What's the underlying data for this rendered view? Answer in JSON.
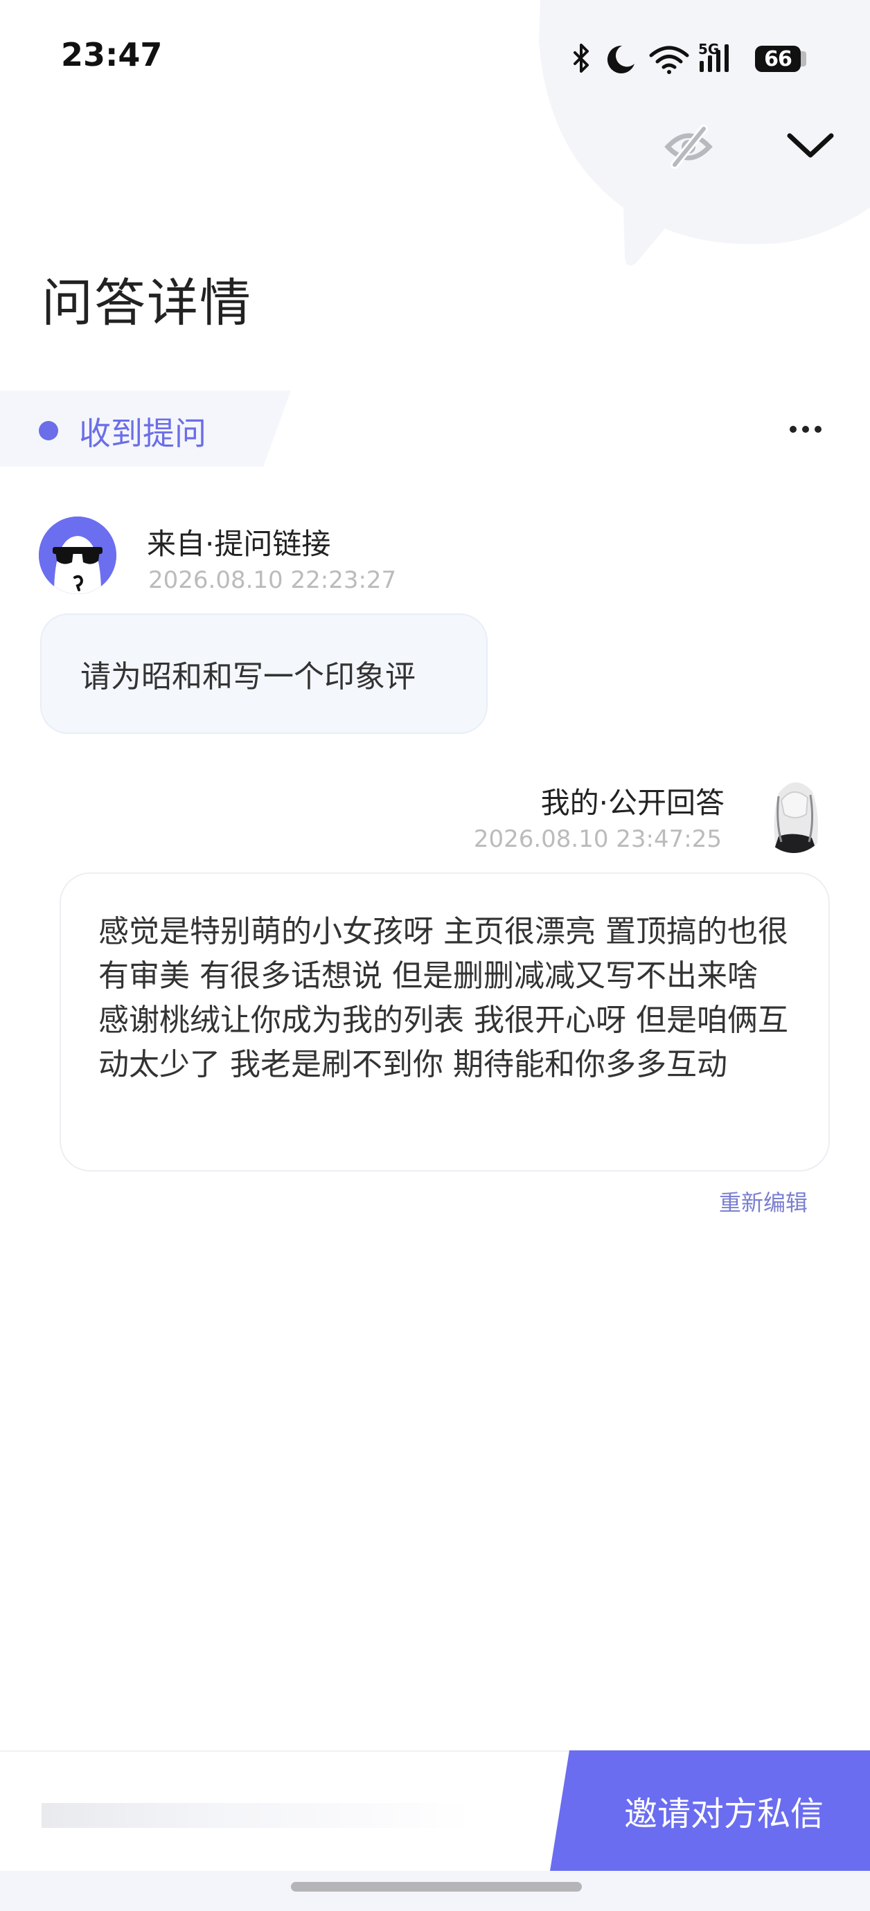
{
  "status_bar": {
    "time": "23:47",
    "network": "5G",
    "battery": "66",
    "icons": [
      "bluetooth-icon",
      "moon-icon",
      "wifi-icon",
      "signal-icon",
      "battery-icon"
    ]
  },
  "header": {
    "title": "问答详情",
    "icons": [
      "eye-off-icon",
      "chevron-down-icon"
    ]
  },
  "section": {
    "status_label": "收到提问",
    "more_icon": "more-horizontal-icon"
  },
  "question": {
    "from": "来自·提问链接",
    "time": "2026.08.10 22:23:27",
    "text": "请为昭和和写一个印象评"
  },
  "answer": {
    "from": "我的·公开回答",
    "time": "2026.08.10 23:47:25",
    "text": "感觉是特别萌的小女孩呀 主页很漂亮 置顶搞的也很有审美 有很多话想说 但是删删减减又写不出来啥 感谢桃绒让你成为我的列表 我很开心呀 但是咱俩互动太少了 我老是刷不到你 期待能和你多多互动",
    "edit_label": "重新编辑"
  },
  "bottom": {
    "invite_label": "邀请对方私信"
  },
  "colors": {
    "accent": "#6a6df0",
    "accent_text": "#6b6ee8",
    "muted": "#bbbbbb"
  }
}
